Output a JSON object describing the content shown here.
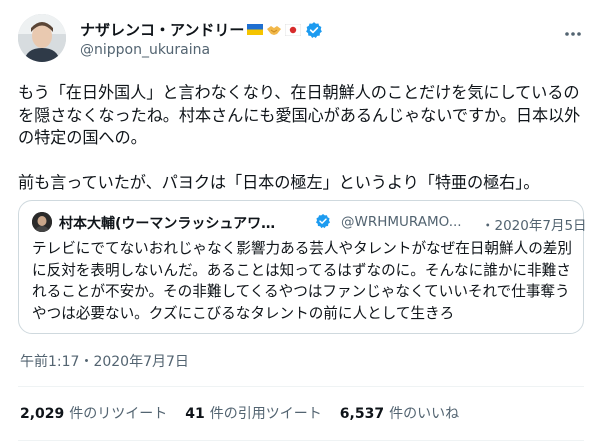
{
  "author": {
    "display_name": "ナザレンコ・アンドリー",
    "handle": "@nippon_ukuraina"
  },
  "tweet": {
    "text": "もう「在日外国人」と言わなくなり、在日朝鮮人のことだけを気にしているのを隠さなくなったね。村本さんにも愛国心があるんじゃないですか。日本以外の特定の国への。\n\n前も言っていたが、パヨクは「日本の極左」というより「特亜の極右」。",
    "timestamp": "午前1:17・2020年7月7日"
  },
  "quoted": {
    "display_name": "村本大輔(ウーマンラッシュアワ…",
    "handle": "@WRHMURAMO...",
    "date": "・2020年7月5日",
    "text": "テレビにでてないおれじゃなく影響力ある芸人やタレントがなぜ在日朝鮮人の差別に反対を表明しないんだ。あることは知ってるはずなのに。そんなに誰かに非難されることが不安か。その非難してくるやつはファンじゃなくていいそれで仕事奪うやつは必要ない。クズにこびるなタレントの前に人として生きろ"
  },
  "stats": [
    {
      "num": "2,029",
      "label": "件のリツイート"
    },
    {
      "num": "41",
      "label": "件の引用ツイート"
    },
    {
      "num": "6,537",
      "label": "件のいいね"
    }
  ],
  "colors": {
    "text": "#0f1419",
    "secondary": "#536471",
    "verified": "#1d9bf0",
    "border": "#cfd9de"
  },
  "icons": [
    "ukraine-flag-icon",
    "handshake-icon",
    "japan-flag-icon",
    "verified-badge-icon",
    "more-icon"
  ]
}
